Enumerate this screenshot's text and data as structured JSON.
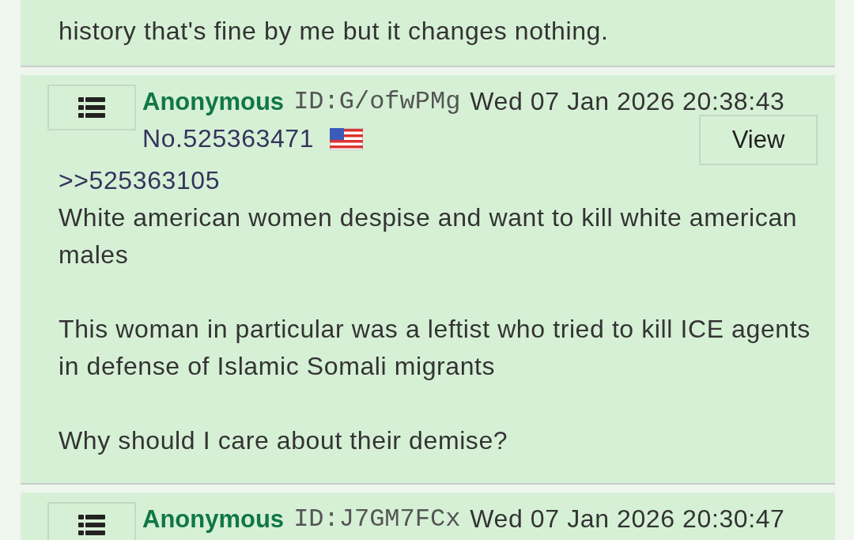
{
  "posts": [
    {
      "body": [
        "history that's fine by me but it changes nothing."
      ]
    },
    {
      "name": "Anonymous",
      "id": "ID:G/ofwPMg",
      "date": "Wed 07 Jan 2026 20:38:43",
      "number": "No.525363471",
      "has_flag": true,
      "view": "View",
      "quote": ">>525363105",
      "body": [
        "White american women despise and want to kill white american males",
        "This woman in particular was a leftist who tried to kill ICE agents in defense of Islamic Somali migrants",
        "Why should I care about their demise?"
      ]
    },
    {
      "name": "Anonymous",
      "id": "ID:J7GM7FCx",
      "date": "Wed 07 Jan 2026 20:30:47"
    }
  ]
}
